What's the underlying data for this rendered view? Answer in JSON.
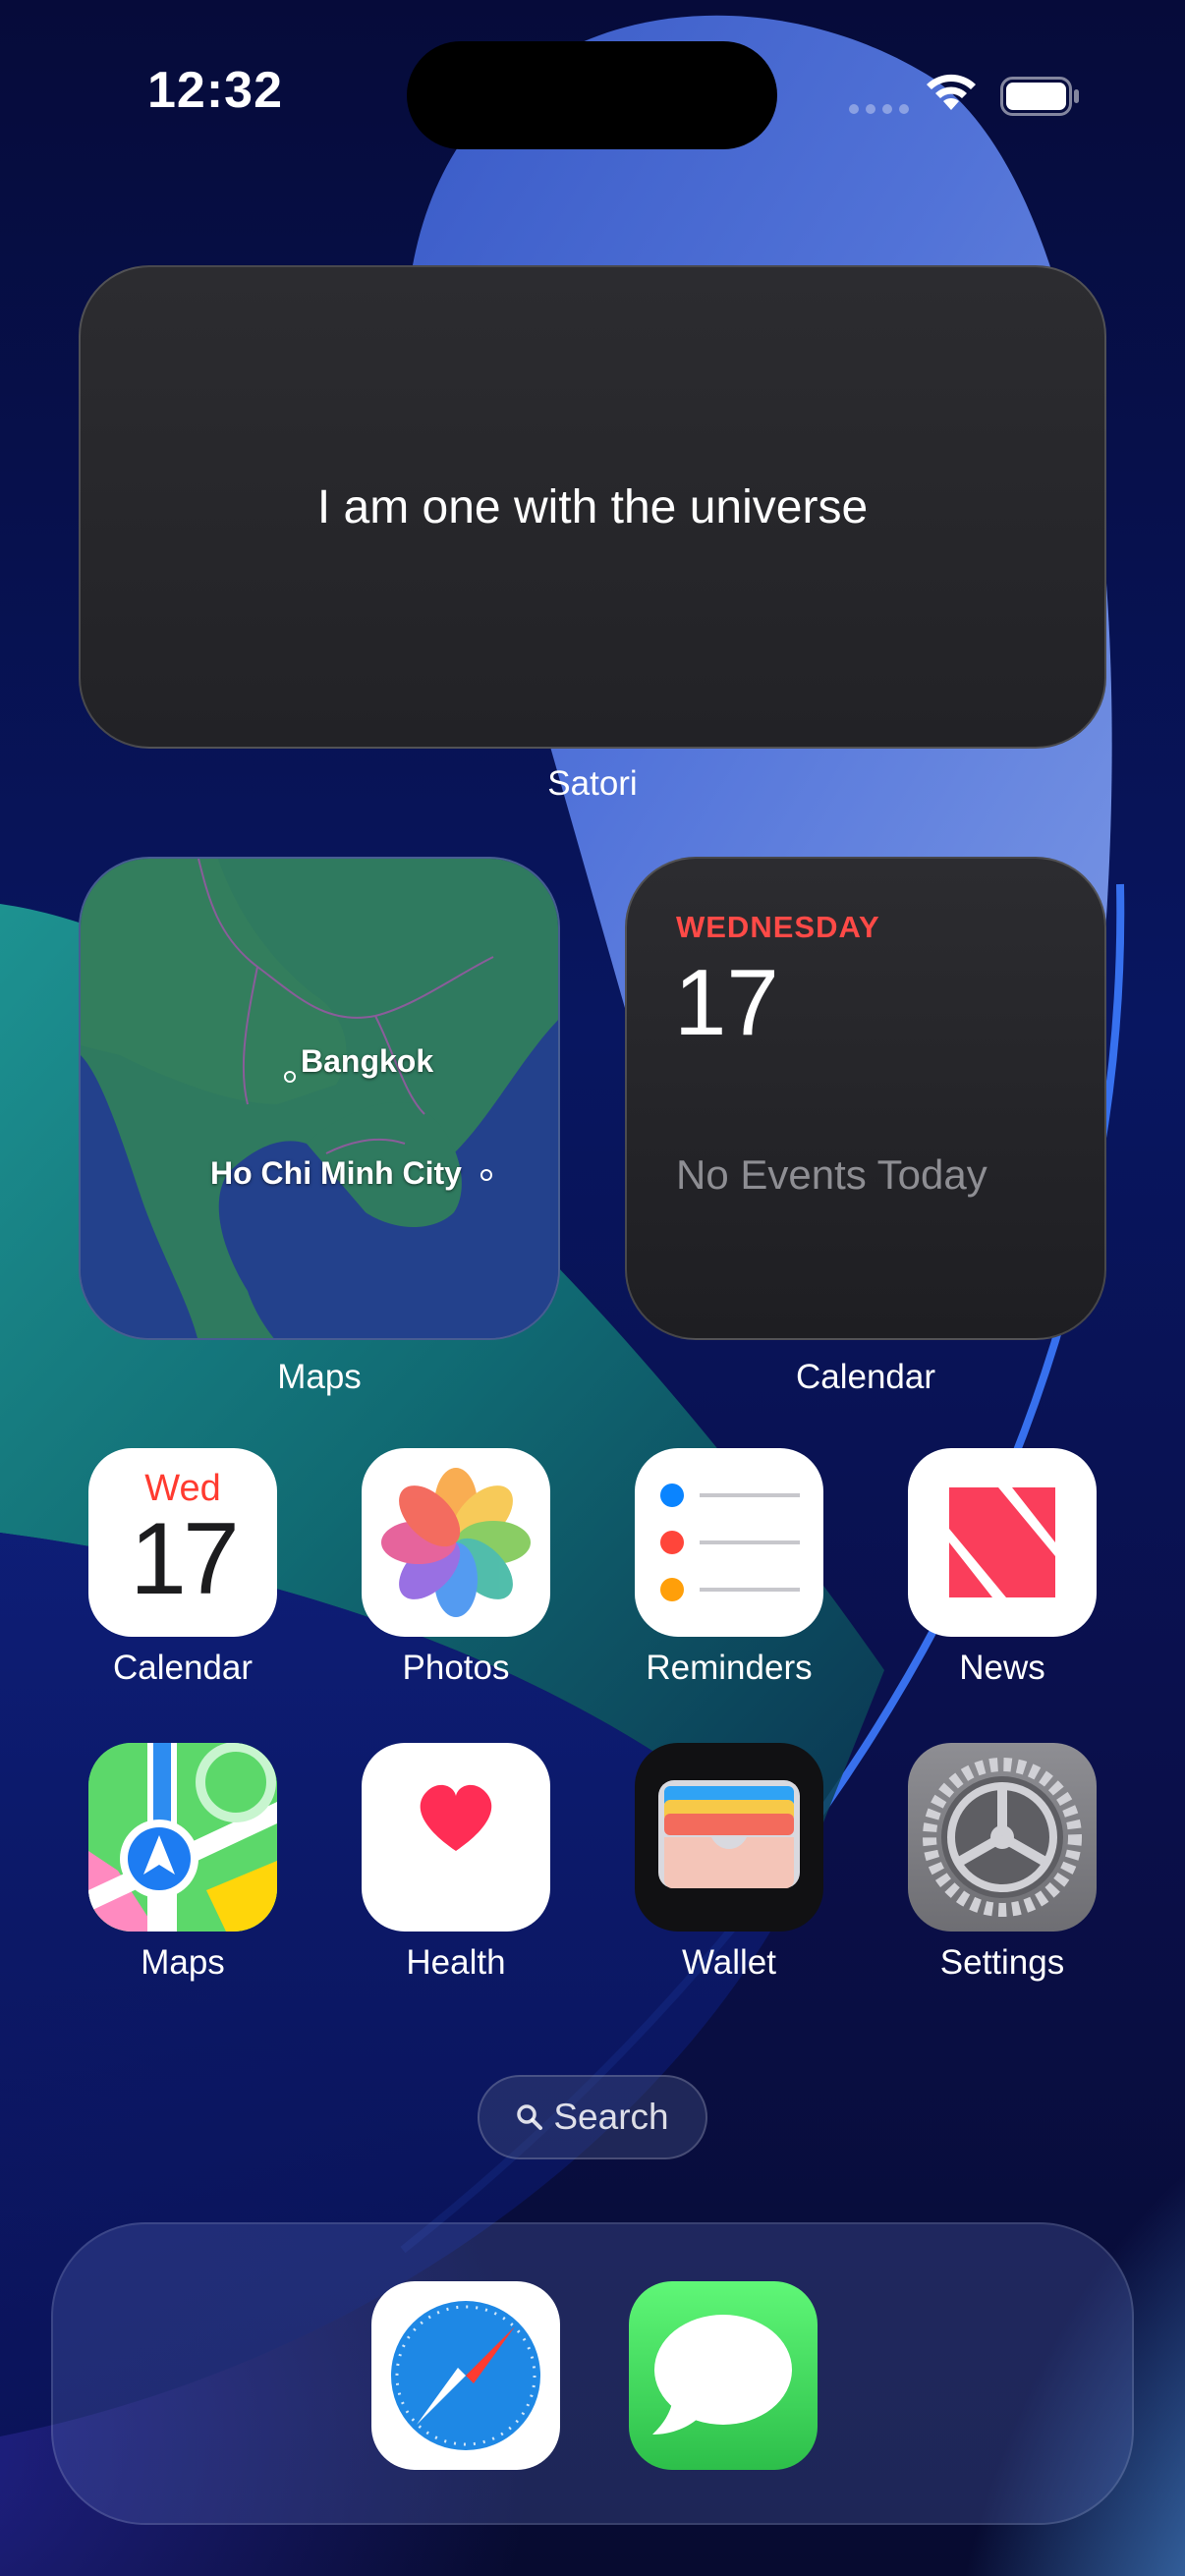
{
  "status_bar": {
    "time": "12:32"
  },
  "widgets": {
    "satori": {
      "text": "I am one with the universe",
      "label": "Satori"
    },
    "maps": {
      "label": "Maps",
      "cities": [
        "Bangkok",
        "Ho Chi Minh City"
      ]
    },
    "calendar": {
      "day": "WEDNESDAY",
      "date": "17",
      "events": "No Events Today",
      "label": "Calendar"
    }
  },
  "apps": [
    {
      "label": "Calendar",
      "icon": "calendar-icon",
      "day": "Wed",
      "date": "17"
    },
    {
      "label": "Photos",
      "icon": "photos-icon"
    },
    {
      "label": "Reminders",
      "icon": "reminders-icon"
    },
    {
      "label": "News",
      "icon": "news-icon"
    },
    {
      "label": "Maps",
      "icon": "maps-icon"
    },
    {
      "label": "Health",
      "icon": "health-icon"
    },
    {
      "label": "Wallet",
      "icon": "wallet-icon"
    },
    {
      "label": "Settings",
      "icon": "settings-icon"
    }
  ],
  "search": {
    "label": "Search"
  },
  "dock": [
    {
      "icon": "safari-icon"
    },
    {
      "icon": "messages-icon"
    }
  ],
  "colors": {
    "calendar_red": "#ff4a47",
    "widget_bg": "#2a2a2e"
  }
}
